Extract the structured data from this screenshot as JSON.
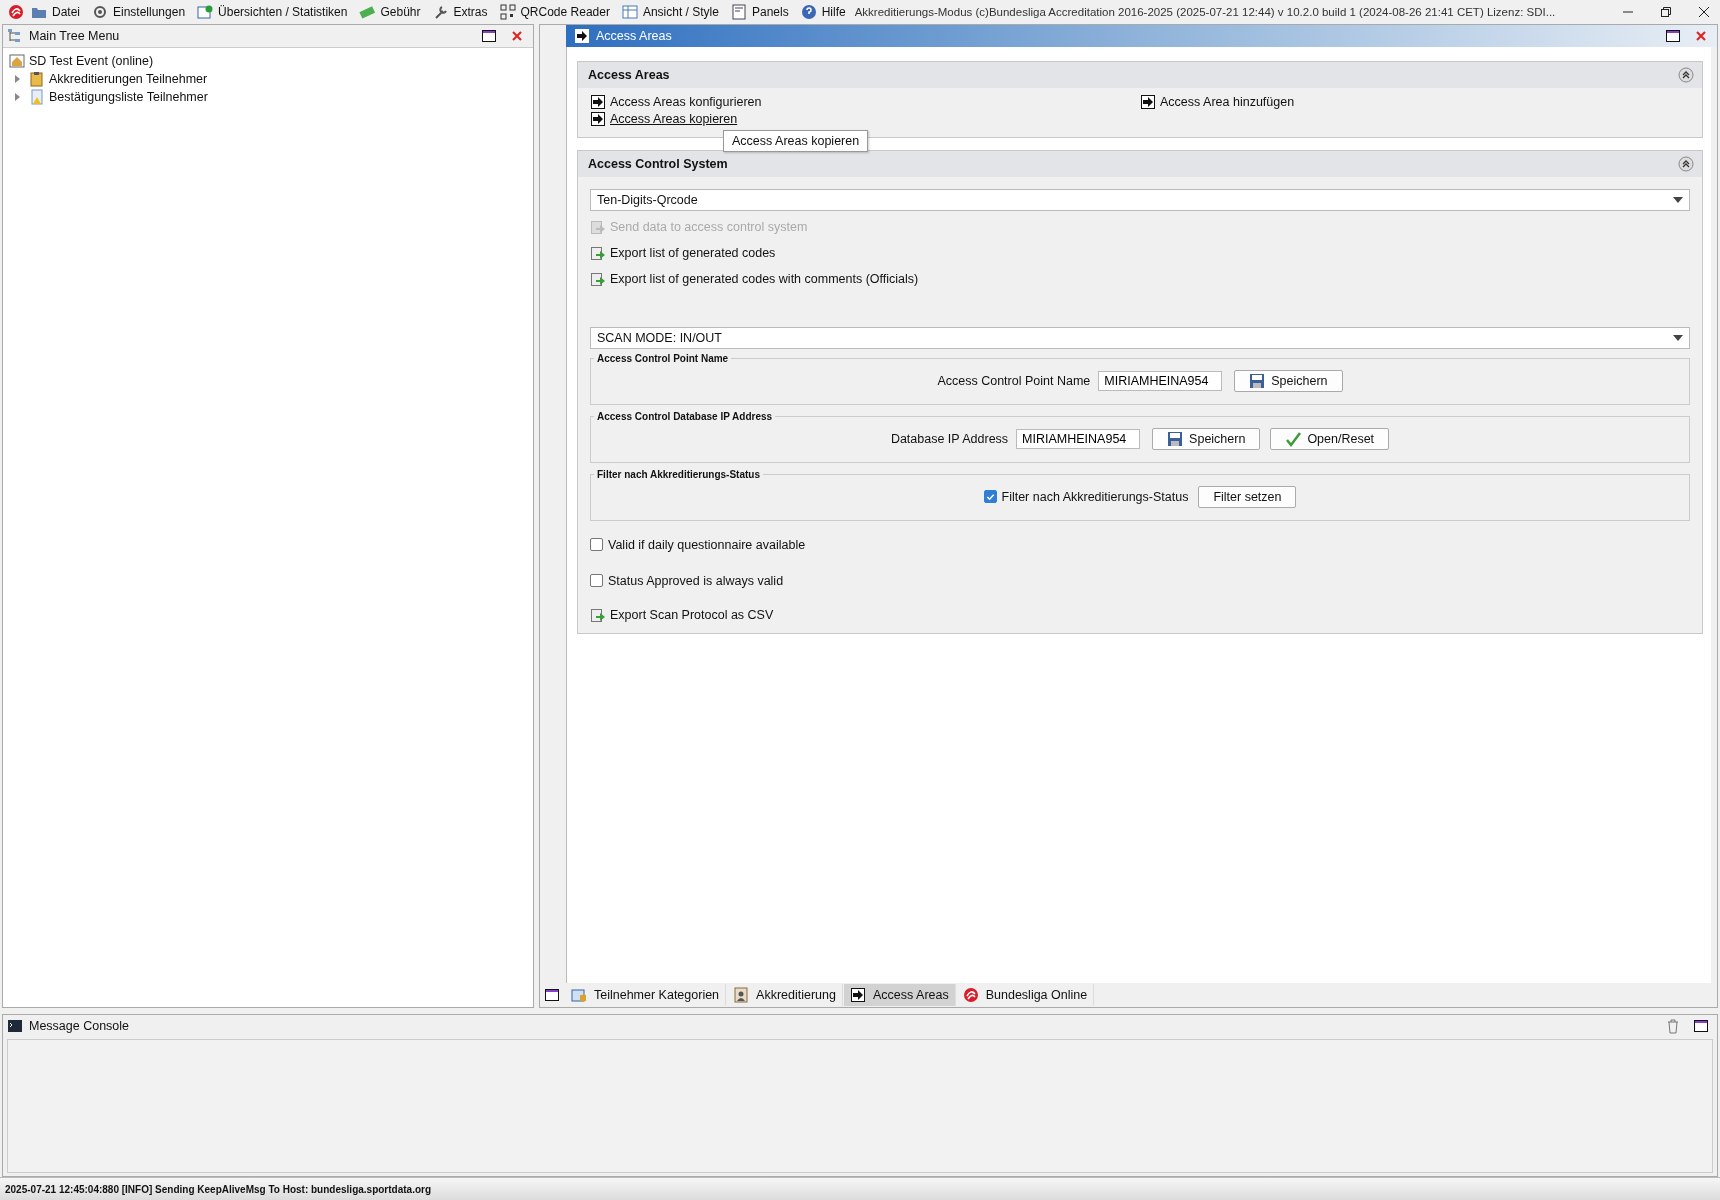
{
  "menu": [
    {
      "label": "Datei"
    },
    {
      "label": "Einstellungen"
    },
    {
      "label": "Übersichten / Statistiken"
    },
    {
      "label": "Gebühr"
    },
    {
      "label": "Extras"
    },
    {
      "label": "QRCode Reader"
    },
    {
      "label": "Ansicht / Style"
    },
    {
      "label": "Panels"
    },
    {
      "label": "Hilfe"
    }
  ],
  "window": {
    "title": "Akkreditierungs-Modus (c)Bundesliga Accreditation 2016-2025 (2025-07-21 12:44) v 10.2.0 build 1 (2024-08-26 21:41 CET) Lizenz: SDI..."
  },
  "left_panel": {
    "title": "Main Tree Menu",
    "tree": [
      {
        "label": "SD Test Event (online)",
        "expanded": true,
        "children": [
          {
            "label": "Akkreditierungen Teilnehmer",
            "expanded": false
          },
          {
            "label": "Bestätigungsliste Teilnehmer",
            "expanded": false
          }
        ]
      }
    ]
  },
  "right_panel": {
    "title": "Access Areas",
    "access_areas": {
      "title": "Access Areas",
      "collapsed": false,
      "links_left": [
        {
          "label": "Access Areas konfigurieren",
          "hovered": false
        },
        {
          "label": "Access Areas kopieren",
          "hovered": true
        }
      ],
      "links_right": [
        {
          "label": "Access Area hinzufügen",
          "hovered": false
        }
      ],
      "tooltip": "Access Areas kopieren"
    },
    "access_control": {
      "title": "Access Control System",
      "collapsed": false,
      "system_select": "Ten-Digits-Qrcode",
      "actions": [
        {
          "label": "Send data to access control system",
          "disabled": true
        },
        {
          "label": "Export list of generated codes",
          "disabled": false
        },
        {
          "label": "Export list of generated codes with comments (Officials)",
          "disabled": false
        }
      ],
      "mode_select": "SCAN MODE: IN/OUT",
      "groups": [
        {
          "title": "Access Control Point Name",
          "kind": "field",
          "label": "Access Control Point Name",
          "value": "MIRIAMHEINA954",
          "buttons": [
            {
              "label": "Speichern",
              "kind": "save"
            }
          ]
        },
        {
          "title": "Access Control Database IP Address",
          "kind": "field",
          "label": "Database IP Address",
          "value": "MIRIAMHEINA954",
          "buttons": [
            {
              "label": "Speichern",
              "kind": "save"
            },
            {
              "label": "Open/Reset",
              "kind": "check"
            }
          ]
        },
        {
          "title": "Filter nach Akkreditierungs-Status",
          "kind": "checkbox",
          "label": "Filter nach Akkreditierungs-Status",
          "checked": true,
          "buttons": [
            {
              "label": "Filter setzen",
              "kind": "plain"
            }
          ]
        }
      ],
      "options": [
        {
          "label": "Valid if daily questionnaire available",
          "checked": false
        },
        {
          "label": "Status Approved is always valid",
          "checked": false
        }
      ],
      "export_scan": "Export Scan Protocol as CSV"
    },
    "tabs": [
      {
        "label": "Teilnehmer Kategorien",
        "selected": false
      },
      {
        "label": "Akkreditierung",
        "selected": false
      },
      {
        "label": "Access Areas",
        "selected": true
      },
      {
        "label": "Bundesliga Online",
        "selected": false
      }
    ]
  },
  "console": {
    "title": "Message Console"
  },
  "status_bar": "2025-07-21 12:45:04:880 [INFO] Sending KeepAliveMsg To Host: bundesliga.sportdata.org"
}
